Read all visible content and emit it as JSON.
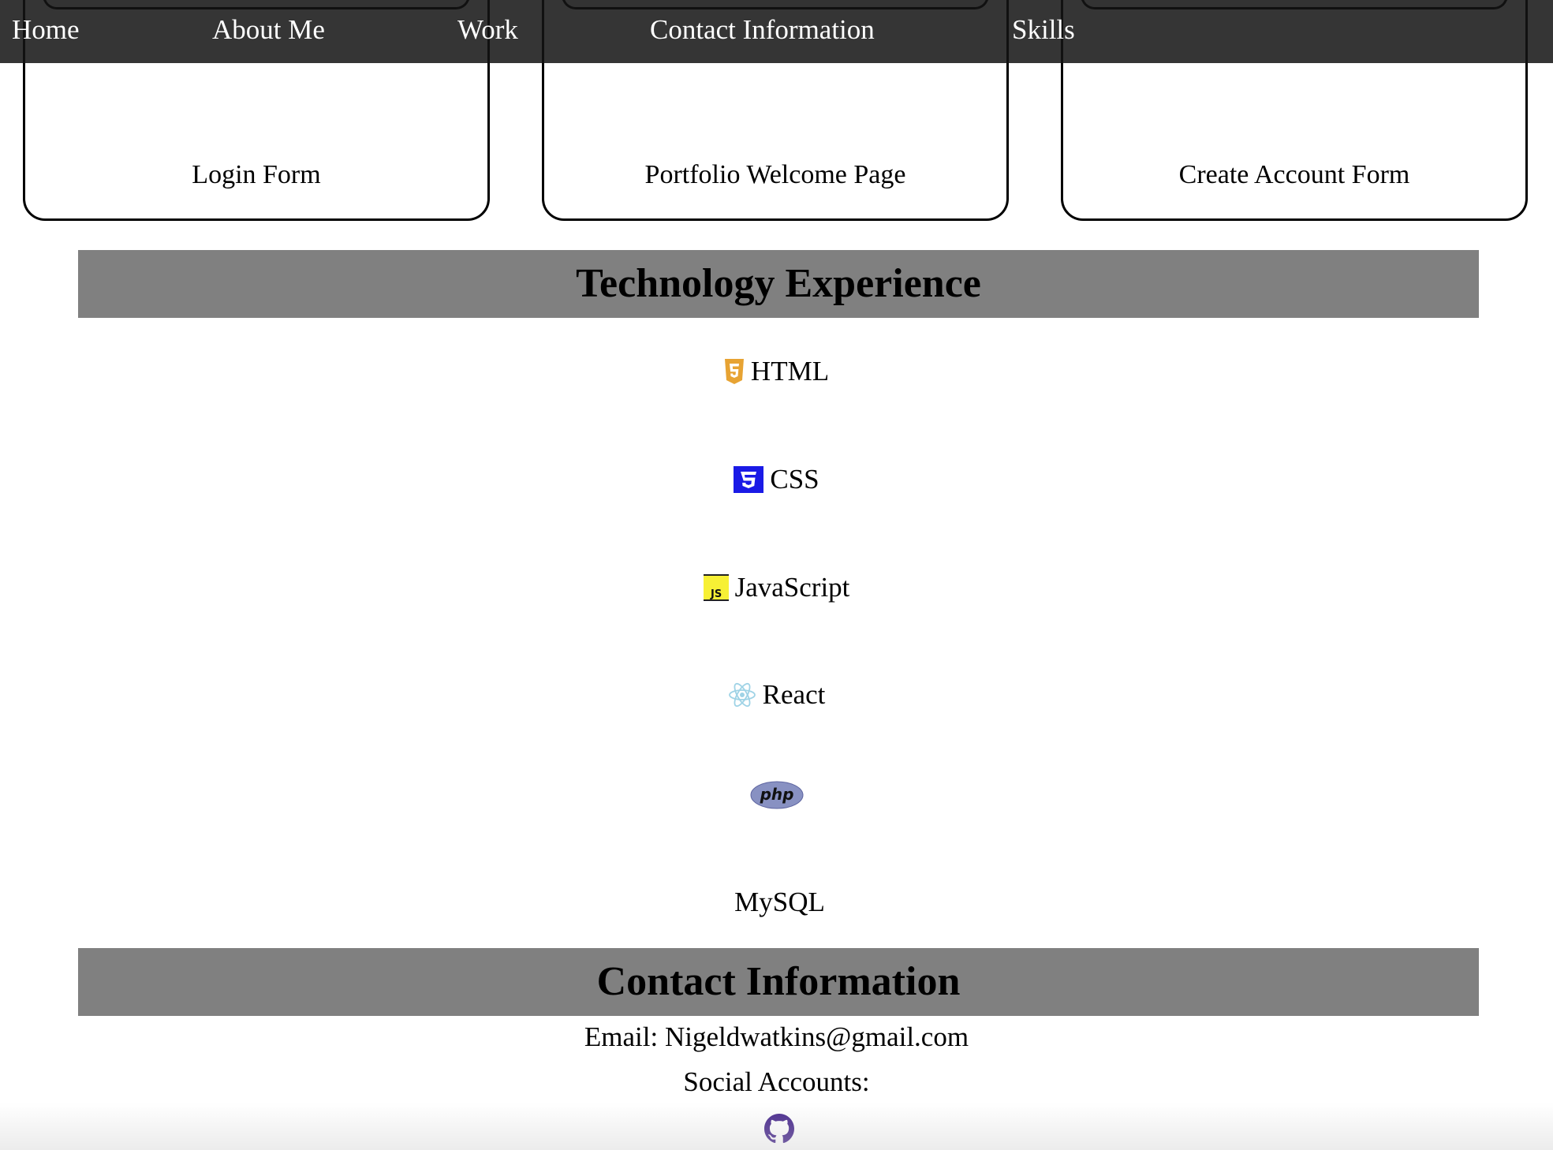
{
  "nav": {
    "items": [
      {
        "label": "Home"
      },
      {
        "label": "About Me"
      },
      {
        "label": "Work"
      },
      {
        "label": "Contact Information"
      },
      {
        "label": "Skills"
      }
    ]
  },
  "work": {
    "cards": [
      {
        "title": "Login Form"
      },
      {
        "title": "Portfolio Welcome Page"
      },
      {
        "title": "Create Account Form"
      }
    ]
  },
  "technology": {
    "heading": "Technology Experience",
    "items": [
      {
        "label": "HTML",
        "icon": "html5-icon",
        "color": "#E7A333"
      },
      {
        "label": "CSS",
        "icon": "css3-icon",
        "color": "#1A1AE6"
      },
      {
        "label": "JavaScript",
        "icon": "javascript-icon",
        "color": "#F7F035"
      },
      {
        "label": "React",
        "icon": "react-icon",
        "color": "#9FD3E6"
      },
      {
        "label": "",
        "icon": "php-icon",
        "color": "#8891C2"
      },
      {
        "label": "MySQL",
        "icon": "mysql-icon"
      }
    ]
  },
  "contact": {
    "heading": "Contact Information",
    "email_line": "Email: Nigeldwatkins@gmail.com",
    "social_label": "Social Accounts:",
    "github_icon": "github-icon",
    "github_color": "#4B2C8F"
  },
  "colors": {
    "nav_bg": "#141414",
    "section_bg": "#808080"
  }
}
